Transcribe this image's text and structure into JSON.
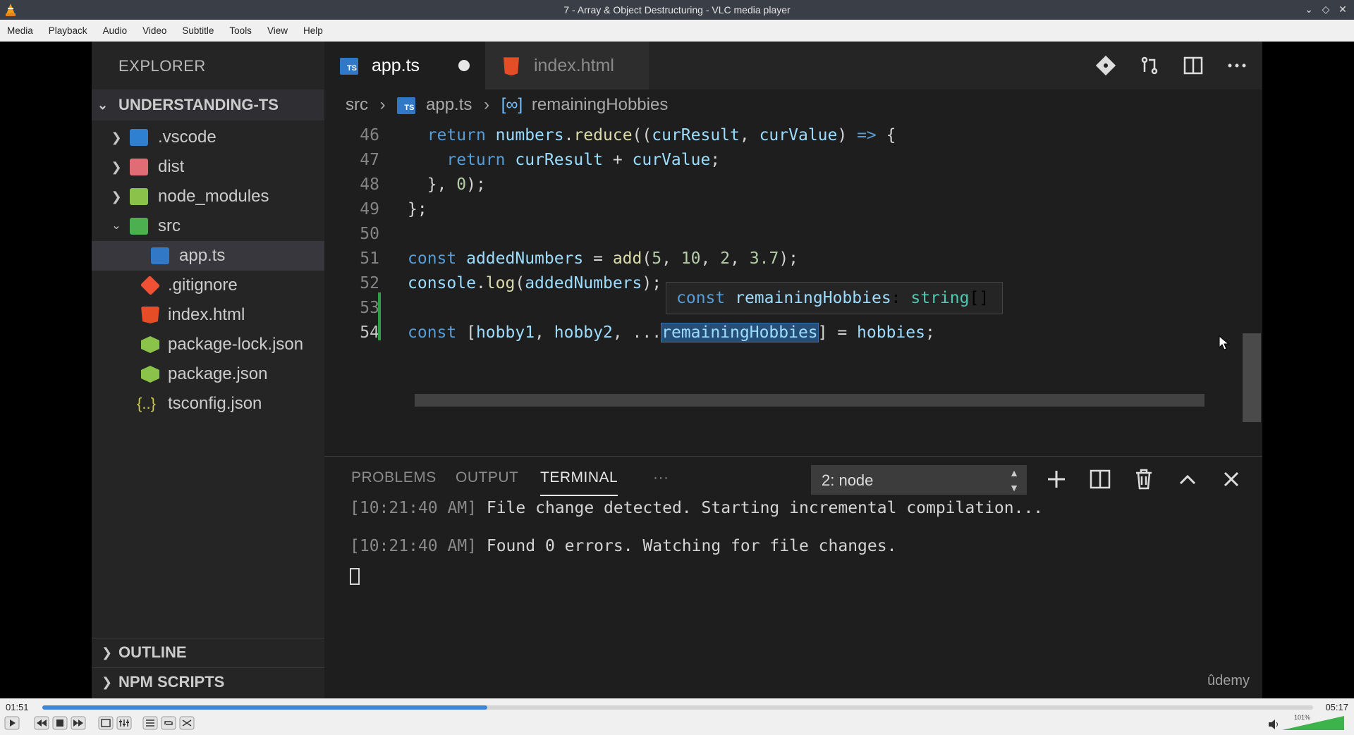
{
  "window": {
    "title": "7 - Array & Object Destructuring - VLC media player",
    "controls": [
      "minimize-icon",
      "maximize-icon",
      "close-icon"
    ]
  },
  "menu": [
    "Media",
    "Playback",
    "Audio",
    "Video",
    "Subtitle",
    "Tools",
    "View",
    "Help"
  ],
  "explorer": {
    "title": "EXPLORER",
    "root": "UNDERSTANDING-TS",
    "items": [
      {
        "label": ".vscode",
        "icon": "vscode-folder-icon",
        "color": "#2f80d1"
      },
      {
        "label": "dist",
        "icon": "dist-folder-icon",
        "color": "#e06c75"
      },
      {
        "label": "node_modules",
        "icon": "node-folder-icon",
        "color": "#8bc34a"
      },
      {
        "label": "src",
        "icon": "src-folder-icon",
        "color": "#4caf50"
      },
      {
        "label": "app.ts",
        "icon": "typescript-file-icon",
        "color": "#3178c6"
      },
      {
        "label": ".gitignore",
        "icon": "git-icon",
        "color": "#f05033"
      },
      {
        "label": "index.html",
        "icon": "html5-icon",
        "color": "#e44d26"
      },
      {
        "label": "package-lock.json",
        "icon": "nodejs-icon",
        "color": "#8bc34a"
      },
      {
        "label": "package.json",
        "icon": "nodejs-icon",
        "color": "#8bc34a"
      },
      {
        "label": "tsconfig.json",
        "icon": "json-braces-icon",
        "color": "#cbcb41"
      }
    ],
    "sections": [
      "OUTLINE",
      "NPM SCRIPTS"
    ]
  },
  "tabs": [
    {
      "label": "app.ts",
      "badge": "TS",
      "modified": true,
      "active": true
    },
    {
      "label": "index.html",
      "active": false
    }
  ],
  "breadcrumb": [
    "src",
    "app.ts",
    "remainingHobbies"
  ],
  "editor": {
    "line_numbers": [
      "46",
      "47",
      "48",
      "49",
      "50",
      "51",
      "52",
      "53",
      "54"
    ],
    "lines": [
      "  return numbers.reduce((curResult, curValue) => {",
      "    return curResult + curValue;",
      "  }, 0);",
      "};",
      "",
      "const addedNumbers = add(5, 10, 2, 3.7);",
      "console.log(addedNumbers);",
      "",
      "const [hobby1, hobby2, ...remainingHobbies] = hobbies;"
    ],
    "selected_word": "remainingHobbies",
    "hover_tooltip": "const remainingHobbies: string[]"
  },
  "panel": {
    "tabs": [
      "PROBLEMS",
      "OUTPUT",
      "TERMINAL",
      "···"
    ],
    "active_tab": "TERMINAL",
    "terminal_select": "2: node",
    "icons": [
      "add-terminal-icon",
      "split-terminal-icon",
      "trash-icon",
      "maximize-panel-icon",
      "close-panel-icon"
    ],
    "lines": [
      {
        "time": "[10:21:40 AM]",
        "text": " File change detected. Starting incremental compilation..."
      },
      {
        "time": "[10:21:40 AM]",
        "text": " Found 0 errors. Watching for file changes."
      }
    ],
    "watermark": "ûdemy"
  },
  "player": {
    "elapsed": "01:51",
    "total": "05:17",
    "progress": 0.35,
    "volume_label": "101%",
    "accent": "#3f86d8"
  }
}
